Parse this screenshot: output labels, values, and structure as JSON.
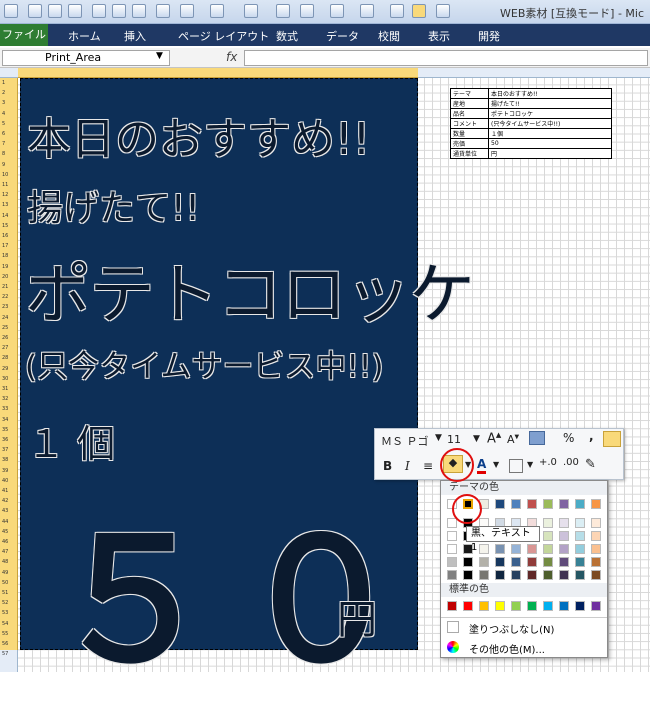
{
  "window": {
    "title": "WEB素材 [互換モード] - Mic"
  },
  "ribbon": {
    "file": "ファイル",
    "tabs": [
      "ホーム",
      "挿入",
      "ページ レイアウト",
      "数式",
      "データ",
      "校閲",
      "表示",
      "開発"
    ]
  },
  "formula_bar": {
    "name_box": "Print_Area",
    "fx": "fx",
    "formula": ""
  },
  "poster": {
    "line1": "本日のおすすめ!!",
    "line2": "揚げたて!!",
    "line3": "ポテトコロッケ",
    "line4": "(只今タイムサービス中!!)",
    "line5": "１ 個",
    "price": "５０",
    "unit": "円"
  },
  "info_table": [
    [
      "テーマ",
      "本日のおすすめ!!"
    ],
    [
      "産地",
      "揚げたて!!"
    ],
    [
      "品名",
      "ポテトコロッケ"
    ],
    [
      "コメント",
      "(只今タイムサービス中!!)"
    ],
    [
      "数量",
      "１個"
    ],
    [
      "売価",
      "50"
    ],
    [
      "通貨単位",
      "円"
    ]
  ],
  "mini_toolbar": {
    "font": "ＭＳ Ｐゴ",
    "size": "11",
    "bold": "B",
    "italic": "I",
    "percent": "%",
    "comma": ","
  },
  "color_palette": {
    "theme_header": "テーマの色",
    "standard_header": "標準の色",
    "no_fill": "塗りつぶしなし(N)",
    "more_colors": "その他の色(M)...",
    "tooltip": "黒、テキスト 1",
    "theme_colors": [
      "#ffffff",
      "#000000",
      "#eeece1",
      "#1f497d",
      "#4f81bd",
      "#c0504d",
      "#9bbb59",
      "#8064a2",
      "#4bacc6",
      "#f79646"
    ],
    "standard_colors": [
      "#c00000",
      "#ff0000",
      "#ffc000",
      "#ffff00",
      "#92d050",
      "#00b050",
      "#00b0f0",
      "#0070c0",
      "#002060",
      "#7030a0"
    ]
  },
  "row_numbers": [
    "1",
    "2",
    "3",
    "4",
    "5",
    "6",
    "7",
    "8",
    "9",
    "10",
    "11",
    "12",
    "13",
    "14",
    "15",
    "16",
    "17",
    "18",
    "19",
    "20",
    "21",
    "22",
    "23",
    "24",
    "25",
    "26",
    "27",
    "28",
    "29",
    "30",
    "31",
    "32",
    "33",
    "34",
    "35",
    "36",
    "37",
    "38",
    "39",
    "40",
    "41",
    "42",
    "43",
    "44",
    "45",
    "46",
    "47",
    "48",
    "49",
    "50",
    "51",
    "52",
    "53",
    "54",
    "55",
    "56",
    "57"
  ]
}
